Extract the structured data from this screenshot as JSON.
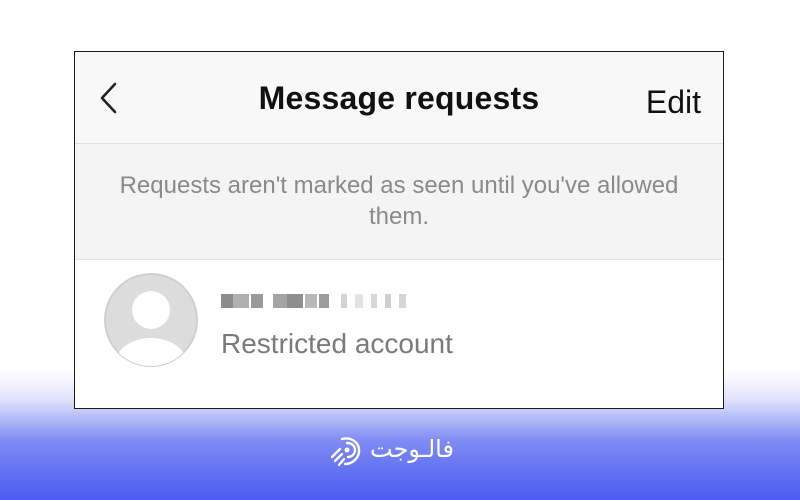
{
  "header": {
    "back_icon": "chevron-left-icon",
    "title": "Message requests",
    "edit_label": "Edit"
  },
  "notice": {
    "text": "Requests aren't marked as seen until you've allowed them."
  },
  "requests": [
    {
      "avatar_icon": "default-avatar-icon",
      "username": "",
      "status": "Restricted account"
    }
  ],
  "watermark": {
    "brand_name": "فالـوجت",
    "icon": "rocket-logo-icon"
  },
  "colors": {
    "accent_gradient": "#4b5bf1",
    "text_primary": "#111111",
    "text_secondary": "#8a8a8a"
  }
}
